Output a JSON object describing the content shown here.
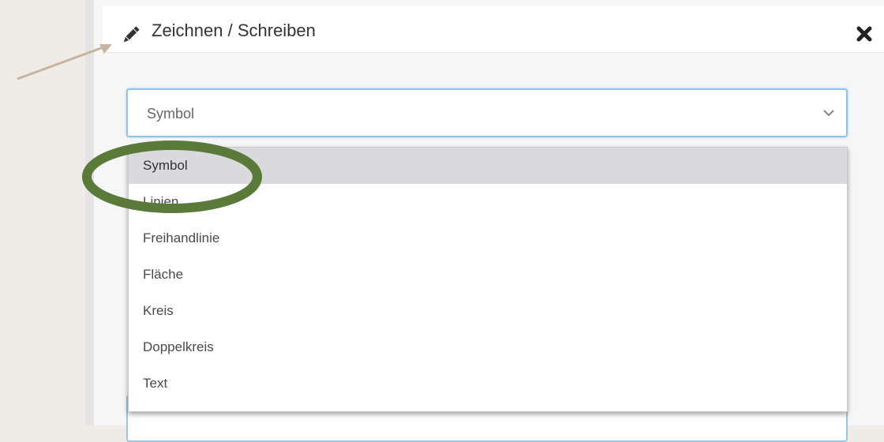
{
  "dialog": {
    "title": "Zeichnen / Schreiben",
    "title_icon": "pencil-icon",
    "close_icon": "close-icon"
  },
  "select": {
    "value": "Symbol",
    "chevron_icon": "chevron-down-icon"
  },
  "dropdown": {
    "options": [
      {
        "label": "Symbol",
        "selected": true
      },
      {
        "label": "Linien"
      },
      {
        "label": "Freihandlinie"
      },
      {
        "label": "Fläche"
      },
      {
        "label": "Kreis"
      },
      {
        "label": "Doppelkreis"
      },
      {
        "label": "Text"
      }
    ]
  },
  "annotations": {
    "arrow_color": "#c8b49e",
    "highlight_color": "#5a7a3a"
  },
  "colors": {
    "background": "#efebe6",
    "select_border": "#8ec3e8",
    "selected_option": "#d9d9de"
  }
}
